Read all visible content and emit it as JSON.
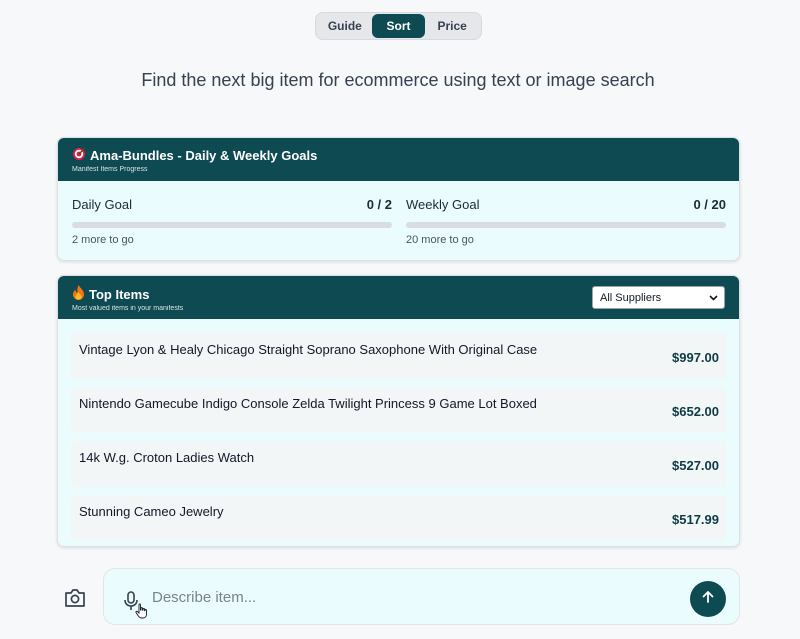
{
  "tabs": [
    {
      "label": "Guide",
      "active": false
    },
    {
      "label": "Sort",
      "active": true
    },
    {
      "label": "Price",
      "active": false
    }
  ],
  "headline": "Find the next big item for ecommerce using text or image search",
  "goals_card": {
    "icon": "target-emoji",
    "title": "Ama-Bundles - Daily & Weekly Goals",
    "subtitle": "Manifest Items Progress",
    "daily": {
      "label": "Daily Goal",
      "count": "0 / 2",
      "progress": 0,
      "remaining": "2 more to go"
    },
    "weekly": {
      "label": "Weekly Goal",
      "count": "0 / 20",
      "progress": 0,
      "remaining": "20 more to go"
    }
  },
  "top_items_card": {
    "icon": "fire-emoji",
    "title": "Top Items",
    "subtitle": "Most valued items in your manifests",
    "supplier_select": {
      "selected": "All Suppliers"
    },
    "items": [
      {
        "name": "Vintage Lyon & Healy Chicago Straight Soprano Saxophone With Original Case",
        "price": "$997.00"
      },
      {
        "name": "Nintendo Gamecube Indigo Console Zelda Twilight Princess 9 Game Lot Boxed",
        "price": "$652.00"
      },
      {
        "name": "14k W.g. Croton Ladies Watch",
        "price": "$527.00"
      },
      {
        "name": "Stunning Cameo Jewelry",
        "price": "$517.99"
      }
    ]
  },
  "search": {
    "placeholder": "Describe item...",
    "value": ""
  },
  "icons": {
    "camera": "camera-icon",
    "mic": "microphone-icon",
    "send": "arrow-up-icon",
    "select": "chevron-down-icon"
  },
  "colors": {
    "accent": "#0d4a52",
    "card_bg": "#eafcfd",
    "item_bg": "#f3f6f7"
  }
}
